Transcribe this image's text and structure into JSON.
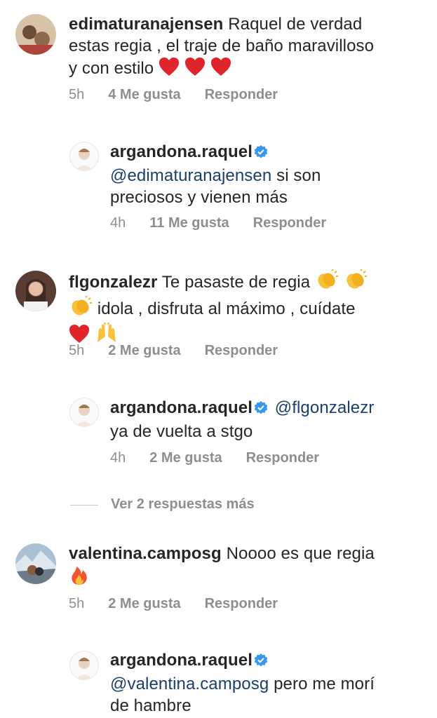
{
  "comments": [
    {
      "username": "edimaturanajensen",
      "text_line1": "Raquel de verdad",
      "text_line2": "estas  regia , el traje de baño maravilloso",
      "text_line3": "y con estilo",
      "time": "5h",
      "likes": "4 Me gusta",
      "reply": "Responder"
    },
    {
      "username": "argandona.raquel",
      "mention": "@edimaturanajensen",
      "text_line1": "si son",
      "text_line2": "preciosos y vienen más",
      "time": "4h",
      "likes": "11 Me gusta",
      "reply": "Responder"
    },
    {
      "username": "flgonzalezr",
      "text_line1": "Te pasaste de regia",
      "text_line2": "idola , disfruta al máximo , cuídate",
      "time": "5h",
      "likes": "2 Me gusta",
      "reply": "Responder"
    },
    {
      "username": "argandona.raquel",
      "mention": "@flgonzalezr",
      "text_line2": "ya de vuelta a stgo",
      "time": "4h",
      "likes": "2 Me gusta",
      "reply": "Responder"
    },
    {
      "username": "valentina.camposg",
      "text_line1": "Noooo es que regia",
      "time": "5h",
      "likes": "2 Me gusta",
      "reply": "Responder"
    },
    {
      "username": "argandona.raquel",
      "mention": "@valentina.camposg",
      "text_line1": "pero me morí",
      "text_line2": "de hambre"
    }
  ],
  "view_more_replies": "Ver 2 respuestas más",
  "colors": {
    "mention": "#1b3f6b",
    "meta": "#8e8e8e",
    "verified": "#3897f0",
    "heart": "#e0242c"
  }
}
